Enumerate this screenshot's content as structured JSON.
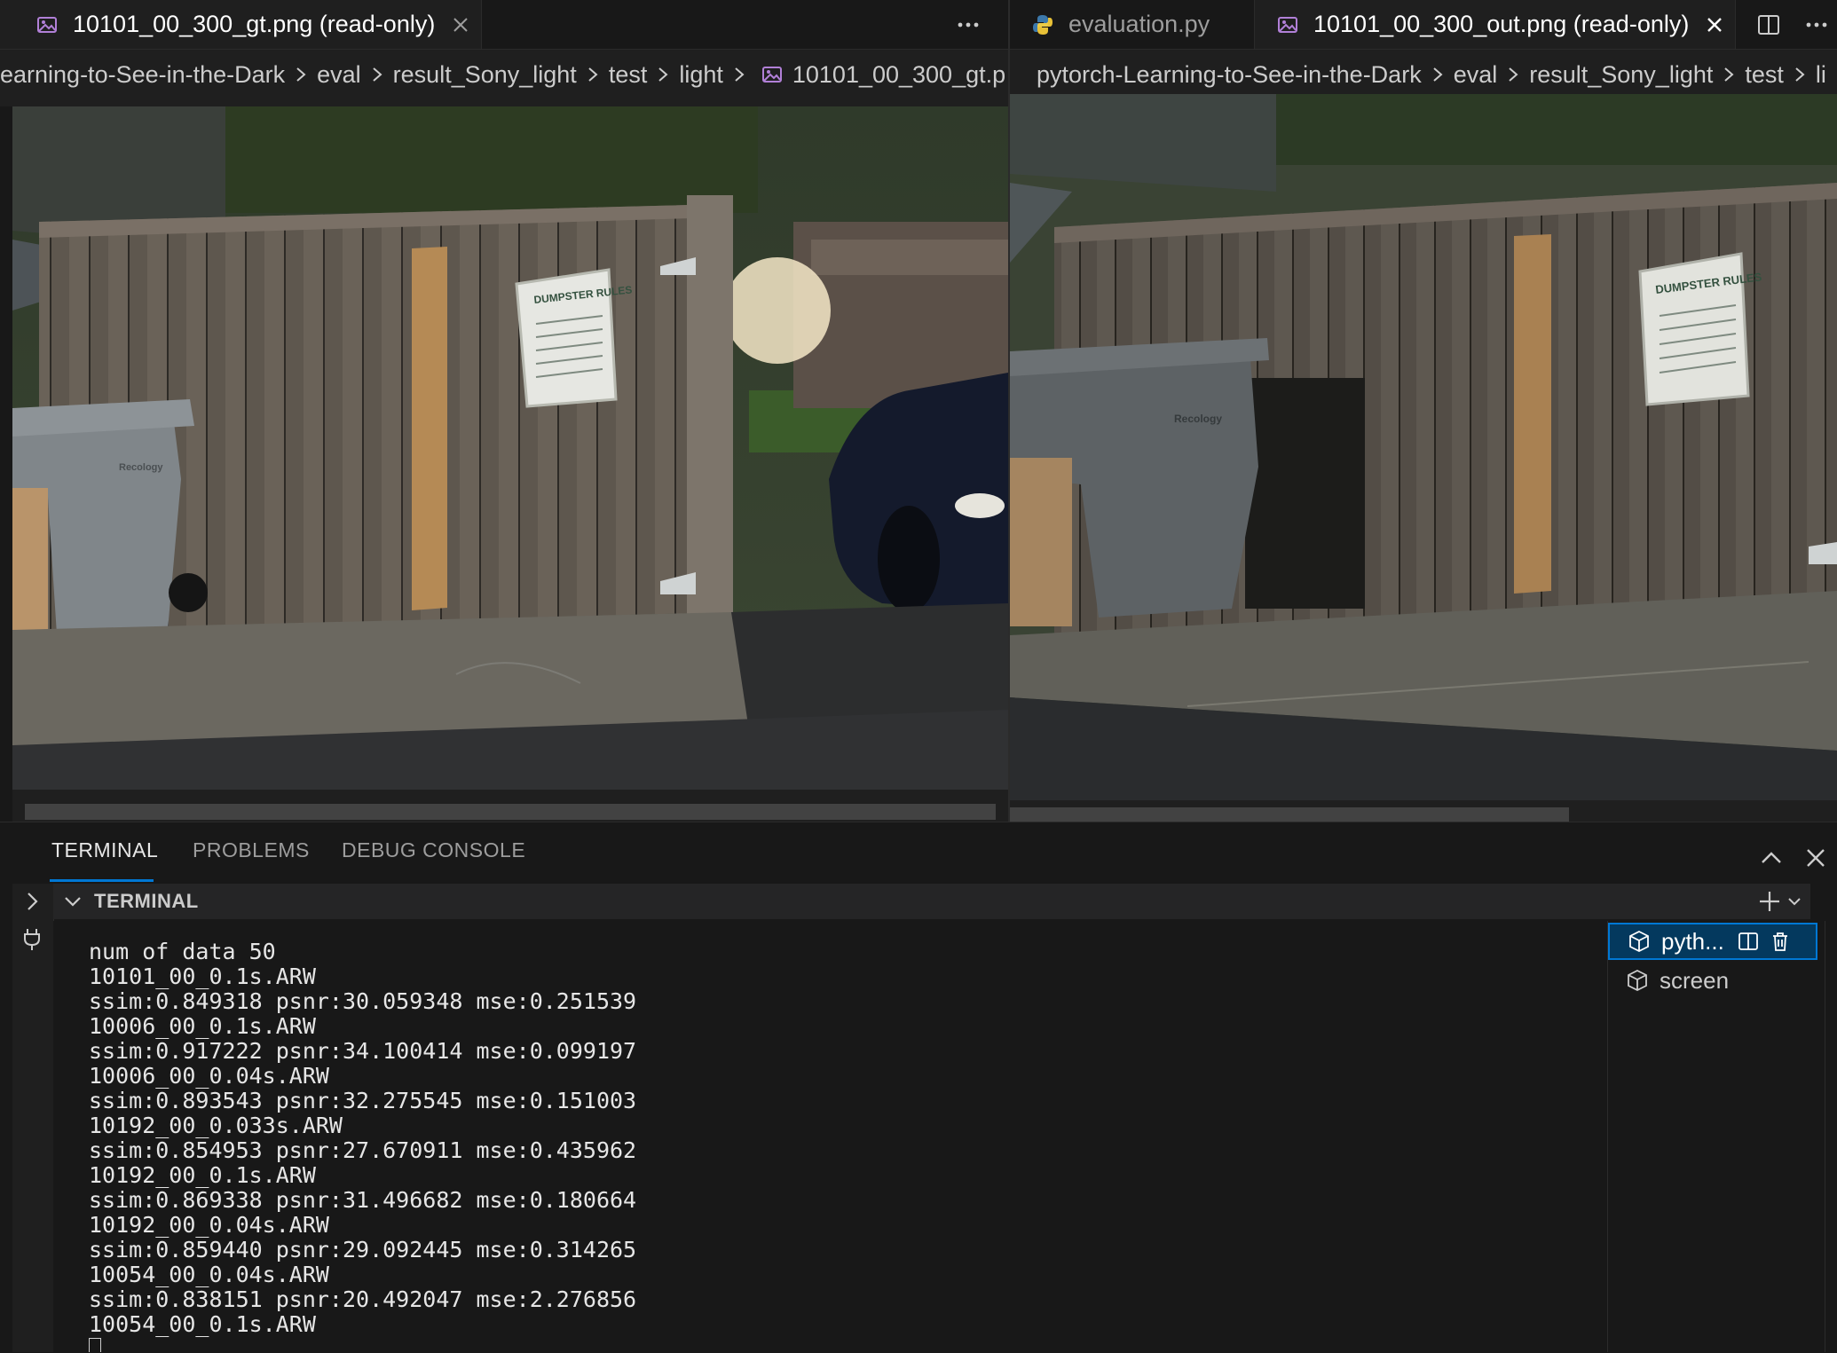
{
  "left_group": {
    "tab": {
      "label": "10101_00_300_gt.png (read-only)"
    },
    "breadcrumb": [
      "earning-to-See-in-the-Dark",
      "eval",
      "result_Sony_light",
      "test",
      "light"
    ],
    "breadcrumb_file": "10101_00_300_gt.p"
  },
  "right_group": {
    "tabs": [
      {
        "label": "evaluation.py"
      },
      {
        "label": "10101_00_300_out.png (read-only)"
      }
    ],
    "breadcrumb": [
      "pytorch-Learning-to-See-in-the-Dark",
      "eval",
      "result_Sony_light",
      "test",
      "li"
    ]
  },
  "images": {
    "left_sign": "DUMPSTER RULES",
    "right_sign": "DUMPSTER RULES",
    "left_bin_label": "Recology",
    "right_bin_label": "Recology"
  },
  "panel": {
    "tabs": [
      "TERMINAL",
      "PROBLEMS",
      "DEBUG CONSOLE"
    ],
    "active_tab": "TERMINAL",
    "section_title": "TERMINAL"
  },
  "terminal": {
    "lines": [
      "num of data 50",
      "10101_00_0.1s.ARW",
      "ssim:0.849318 psnr:30.059348 mse:0.251539",
      "10006_00_0.1s.ARW",
      "ssim:0.917222 psnr:34.100414 mse:0.099197",
      "10006_00_0.04s.ARW",
      "ssim:0.893543 psnr:32.275545 mse:0.151003",
      "10192_00_0.033s.ARW",
      "ssim:0.854953 psnr:27.670911 mse:0.435962",
      "10192_00_0.1s.ARW",
      "ssim:0.869338 psnr:31.496682 mse:0.180664",
      "10192_00_0.04s.ARW",
      "ssim:0.859440 psnr:29.092445 mse:0.314265",
      "10054_00_0.04s.ARW",
      "ssim:0.838151 psnr:20.492047 mse:2.276856",
      "10054_00_0.1s.ARW"
    ]
  },
  "terminal_list": [
    {
      "label": "pyth...",
      "selected": true
    },
    {
      "label": "screen",
      "selected": false
    }
  ],
  "colors": {
    "accent": "#0078d4",
    "editor_bg": "#1f1f1f",
    "tabbar_bg": "#181818",
    "image_icon": "#b180d7",
    "python_blue": "#3c78aa",
    "python_yellow": "#ffd43b"
  }
}
